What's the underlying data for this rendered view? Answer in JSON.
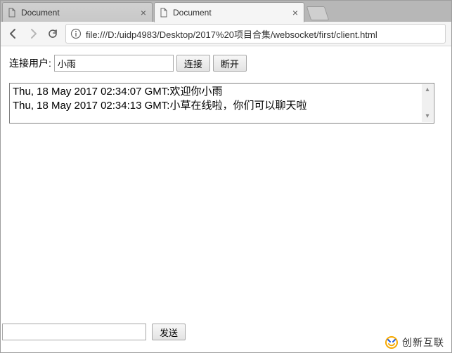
{
  "browser": {
    "tabs": [
      {
        "title": "Document",
        "active": false
      },
      {
        "title": "Document",
        "active": true
      }
    ],
    "url": "file:///D:/uidp4983/Desktop/2017%20项目合集/websocket/first/client.html"
  },
  "form": {
    "user_label": "连接用户:",
    "user_value": "小雨",
    "connect_btn": "连接",
    "disconnect_btn": "断开"
  },
  "log": {
    "lines": [
      "Thu, 18 May 2017 02:34:07 GMT:欢迎你小雨",
      "Thu, 18 May 2017 02:34:13 GMT:小草在线啦，你们可以聊天啦"
    ]
  },
  "send": {
    "msg_value": "",
    "send_btn": "发送"
  },
  "watermark": {
    "brand": "创新互联"
  }
}
